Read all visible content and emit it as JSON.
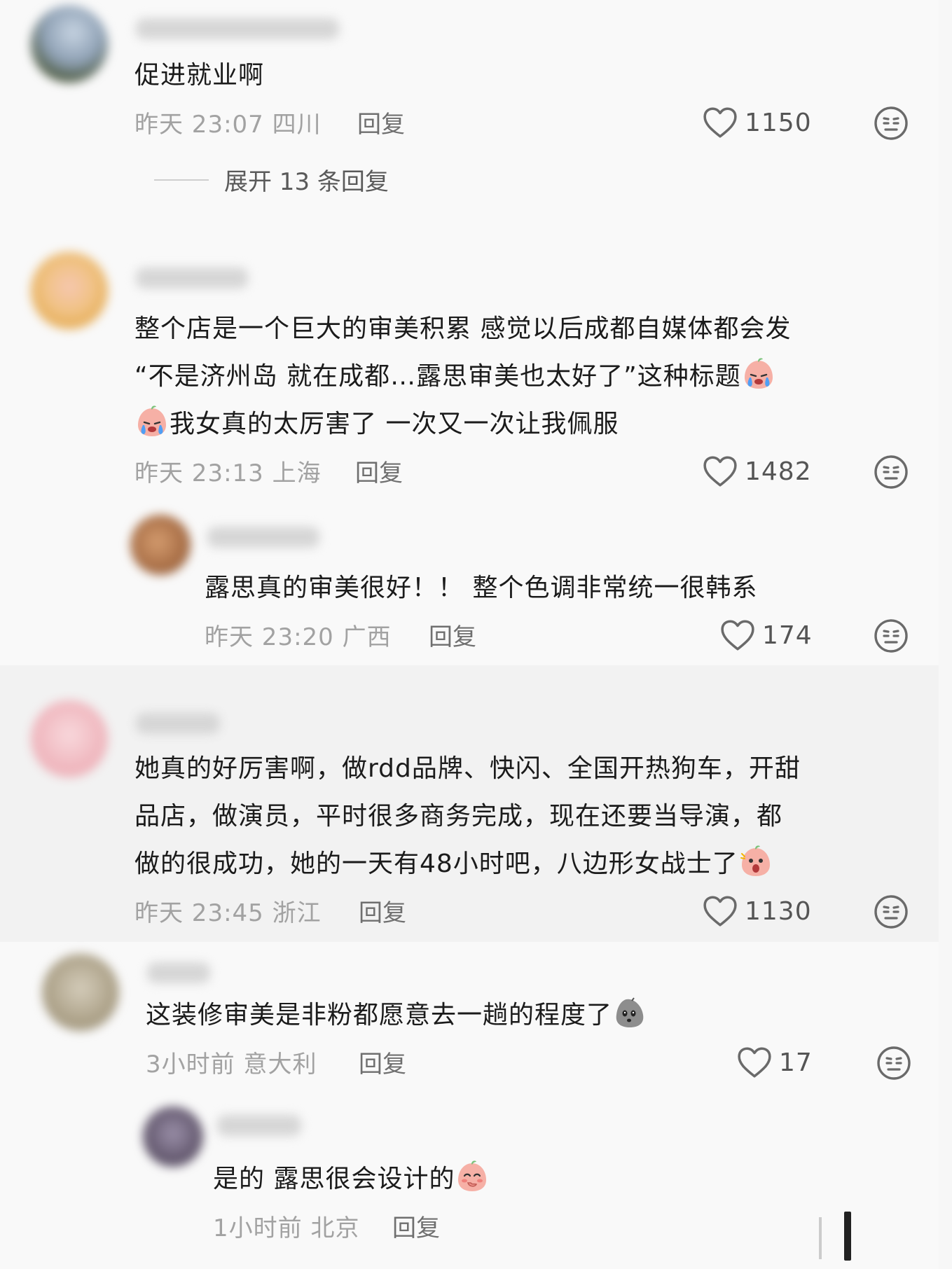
{
  "comments": [
    {
      "text": "促进就业啊",
      "time": "昨天 23:07 四川",
      "reply": "回复",
      "likes": "1150",
      "expand": "展开 13 条回复"
    },
    {
      "text_l1": "整个店是一个巨大的审美积累 感觉以后成都自媒体都会发",
      "text_l2": "“不是济州岛 就在成都…露思审美也太好了”这种标题",
      "text_l3": "我女真的太厉害了 一次又一次让我佩服",
      "time": "昨天 23:13 上海",
      "reply": "回复",
      "likes": "1482"
    },
    {
      "text": "露思真的审美很好！！ 整个色调非常统一很韩系",
      "time": "昨天 23:20 广西",
      "reply": "回复",
      "likes": "174"
    },
    {
      "text_l1": "她真的好厉害啊，做rdd品牌、快闪、全国开热狗车，开甜",
      "text_l2": "品店，做演员，平时很多商务完成，现在还要当导演，都",
      "text_l3": "做的很成功，她的一天有48小时吧，八边形女战士了",
      "time": "昨天 23:45 浙江",
      "reply": "回复",
      "likes": "1130"
    },
    {
      "text": "这装修审美是非粉都愿意去一趟的程度了",
      "time": "3小时前 意大利",
      "reply": "回复",
      "likes": "17"
    },
    {
      "text": "是的 露思很会设计的",
      "time": "1小时前 北京",
      "reply": "回复"
    }
  ],
  "icons": {
    "like": "heart-outline-icon",
    "dislike": "meh-face-icon",
    "emoji_cry": "crying-emoji-icon",
    "emoji_wow": "amazed-emoji-icon",
    "emoji_rock": "rock-face-emoji-icon",
    "emoji_shy": "shy-emoji-icon"
  }
}
